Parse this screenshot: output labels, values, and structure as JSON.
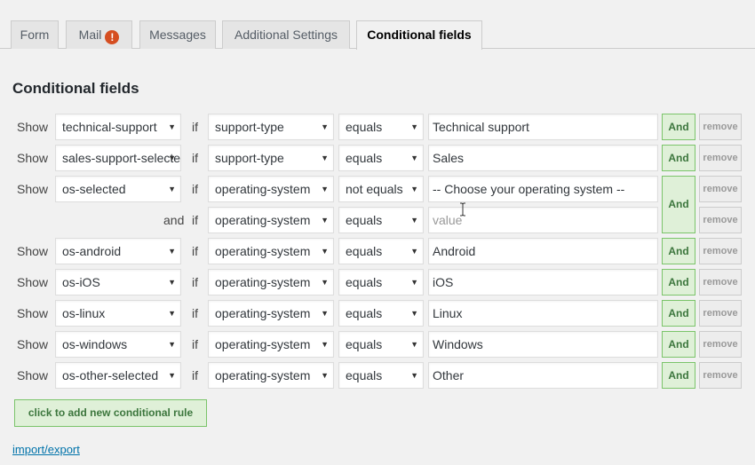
{
  "tabs": [
    {
      "label": "Form",
      "active": false
    },
    {
      "label": "Mail",
      "active": false,
      "badge": "!"
    },
    {
      "label": "Messages",
      "active": false
    },
    {
      "label": "Additional Settings",
      "active": false
    },
    {
      "label": "Conditional fields",
      "active": true
    }
  ],
  "section_title": "Conditional fields",
  "labels": {
    "show": "Show",
    "if": "if",
    "and_text": "and"
  },
  "buttons": {
    "and": "And",
    "remove": "remove",
    "add_rule": "click to add new conditional rule"
  },
  "rules": [
    {
      "field": "technical-support",
      "conditions": [
        {
          "if_field": "support-type",
          "operator": "equals",
          "value": "Technical support"
        }
      ]
    },
    {
      "field": "sales-support-selected",
      "conditions": [
        {
          "if_field": "support-type",
          "operator": "equals",
          "value": "Sales"
        }
      ]
    },
    {
      "field": "os-selected",
      "conditions": [
        {
          "if_field": "operating-system",
          "operator": "not equals",
          "value": "-- Choose your operating system --"
        },
        {
          "if_field": "operating-system",
          "operator": "equals",
          "value": "",
          "placeholder": "value"
        }
      ]
    },
    {
      "field": "os-android",
      "conditions": [
        {
          "if_field": "operating-system",
          "operator": "equals",
          "value": "Android"
        }
      ]
    },
    {
      "field": "os-iOS",
      "conditions": [
        {
          "if_field": "operating-system",
          "operator": "equals",
          "value": "iOS"
        }
      ]
    },
    {
      "field": "os-linux",
      "conditions": [
        {
          "if_field": "operating-system",
          "operator": "equals",
          "value": "Linux"
        }
      ]
    },
    {
      "field": "os-windows",
      "conditions": [
        {
          "if_field": "operating-system",
          "operator": "equals",
          "value": "Windows"
        }
      ]
    },
    {
      "field": "os-other-selected",
      "conditions": [
        {
          "if_field": "operating-system",
          "operator": "equals",
          "value": "Other"
        }
      ]
    }
  ],
  "import_export": "import/export",
  "icons": {
    "dropdown": "caret-down-icon",
    "warning": "exclamation-icon",
    "cursor": "text-cursor-icon"
  },
  "colors": {
    "and_bg": "#dff0d8",
    "and_border": "#7bc46a",
    "and_text": "#3c763d",
    "link": "#0073aa",
    "warning": "#d54e21"
  }
}
